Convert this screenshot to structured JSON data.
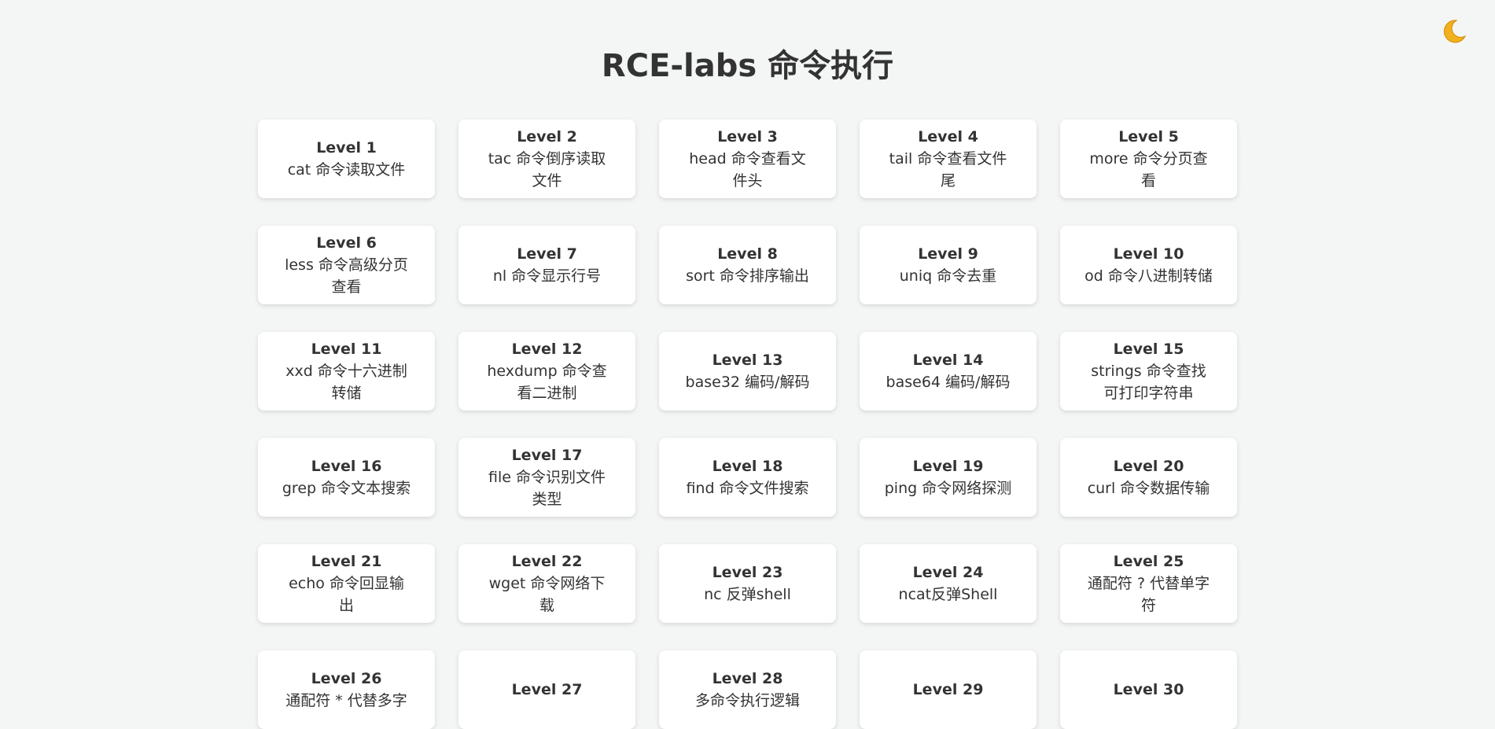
{
  "header": {
    "title": "RCE-labs 命令执行"
  },
  "theme_toggle": {
    "icon": "moon-icon",
    "glyph": "🌙",
    "color": "#f2b01e"
  },
  "levels": [
    {
      "level": "Level 1",
      "desc": "cat 命令读取文件"
    },
    {
      "level": "Level 2",
      "desc": "tac 命令倒序读取文件"
    },
    {
      "level": "Level 3",
      "desc": "head 命令查看文件头"
    },
    {
      "level": "Level 4",
      "desc": "tail 命令查看文件尾"
    },
    {
      "level": "Level 5",
      "desc": "more 命令分页查看"
    },
    {
      "level": "Level 6",
      "desc": "less 命令高级分页查看"
    },
    {
      "level": "Level 7",
      "desc": "nl 命令显示行号"
    },
    {
      "level": "Level 8",
      "desc": "sort 命令排序输出"
    },
    {
      "level": "Level 9",
      "desc": "uniq 命令去重"
    },
    {
      "level": "Level 10",
      "desc": "od 命令八进制转储"
    },
    {
      "level": "Level 11",
      "desc": "xxd 命令十六进制转储"
    },
    {
      "level": "Level 12",
      "desc": "hexdump 命令查看二进制"
    },
    {
      "level": "Level 13",
      "desc": "base32 编码/解码"
    },
    {
      "level": "Level 14",
      "desc": "base64 编码/解码"
    },
    {
      "level": "Level 15",
      "desc": "strings 命令查找可打印字符串"
    },
    {
      "level": "Level 16",
      "desc": "grep 命令文本搜索"
    },
    {
      "level": "Level 17",
      "desc": "file 命令识别文件类型"
    },
    {
      "level": "Level 18",
      "desc": "find 命令文件搜索"
    },
    {
      "level": "Level 19",
      "desc": "ping 命令网络探测"
    },
    {
      "level": "Level 20",
      "desc": "curl 命令数据传输"
    },
    {
      "level": "Level 21",
      "desc": "echo 命令回显输出"
    },
    {
      "level": "Level 22",
      "desc": "wget 命令网络下载"
    },
    {
      "level": "Level 23",
      "desc": "nc 反弹shell"
    },
    {
      "level": "Level 24",
      "desc": "ncat反弹Shell"
    },
    {
      "level": "Level 25",
      "desc": "通配符 ? 代替单字符"
    },
    {
      "level": "Level 26",
      "desc": "通配符 * 代替多字"
    },
    {
      "level": "Level 27",
      "desc": ""
    },
    {
      "level": "Level 28",
      "desc": "多命令执行逻辑"
    },
    {
      "level": "Level 29",
      "desc": ""
    },
    {
      "level": "Level 30",
      "desc": ""
    }
  ]
}
